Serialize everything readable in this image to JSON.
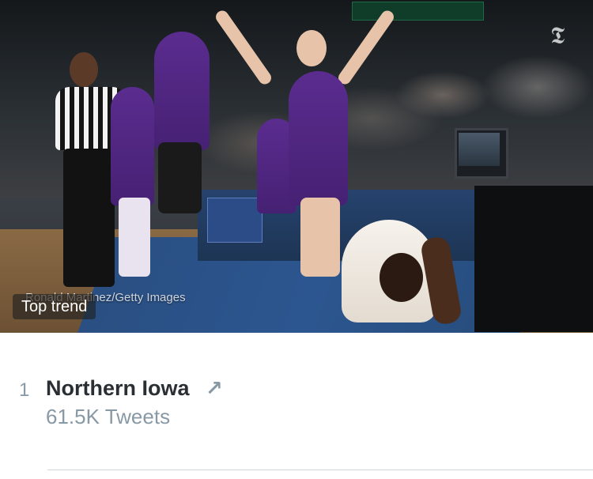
{
  "hero": {
    "photo_credit": "Ronald Martinez/Getty Images",
    "badge_label": "Top trend",
    "logo_glyph": "𝕿"
  },
  "trend": {
    "rank": "1",
    "name": "Northern Iowa",
    "direction_icon": "arrow-up-right-icon",
    "direction_glyph": "↗",
    "tweet_count": "61.5K Tweets"
  },
  "colors": {
    "primary_text": "#292f33",
    "secondary_text": "#8899a6",
    "divider": "#cfd6dc"
  }
}
